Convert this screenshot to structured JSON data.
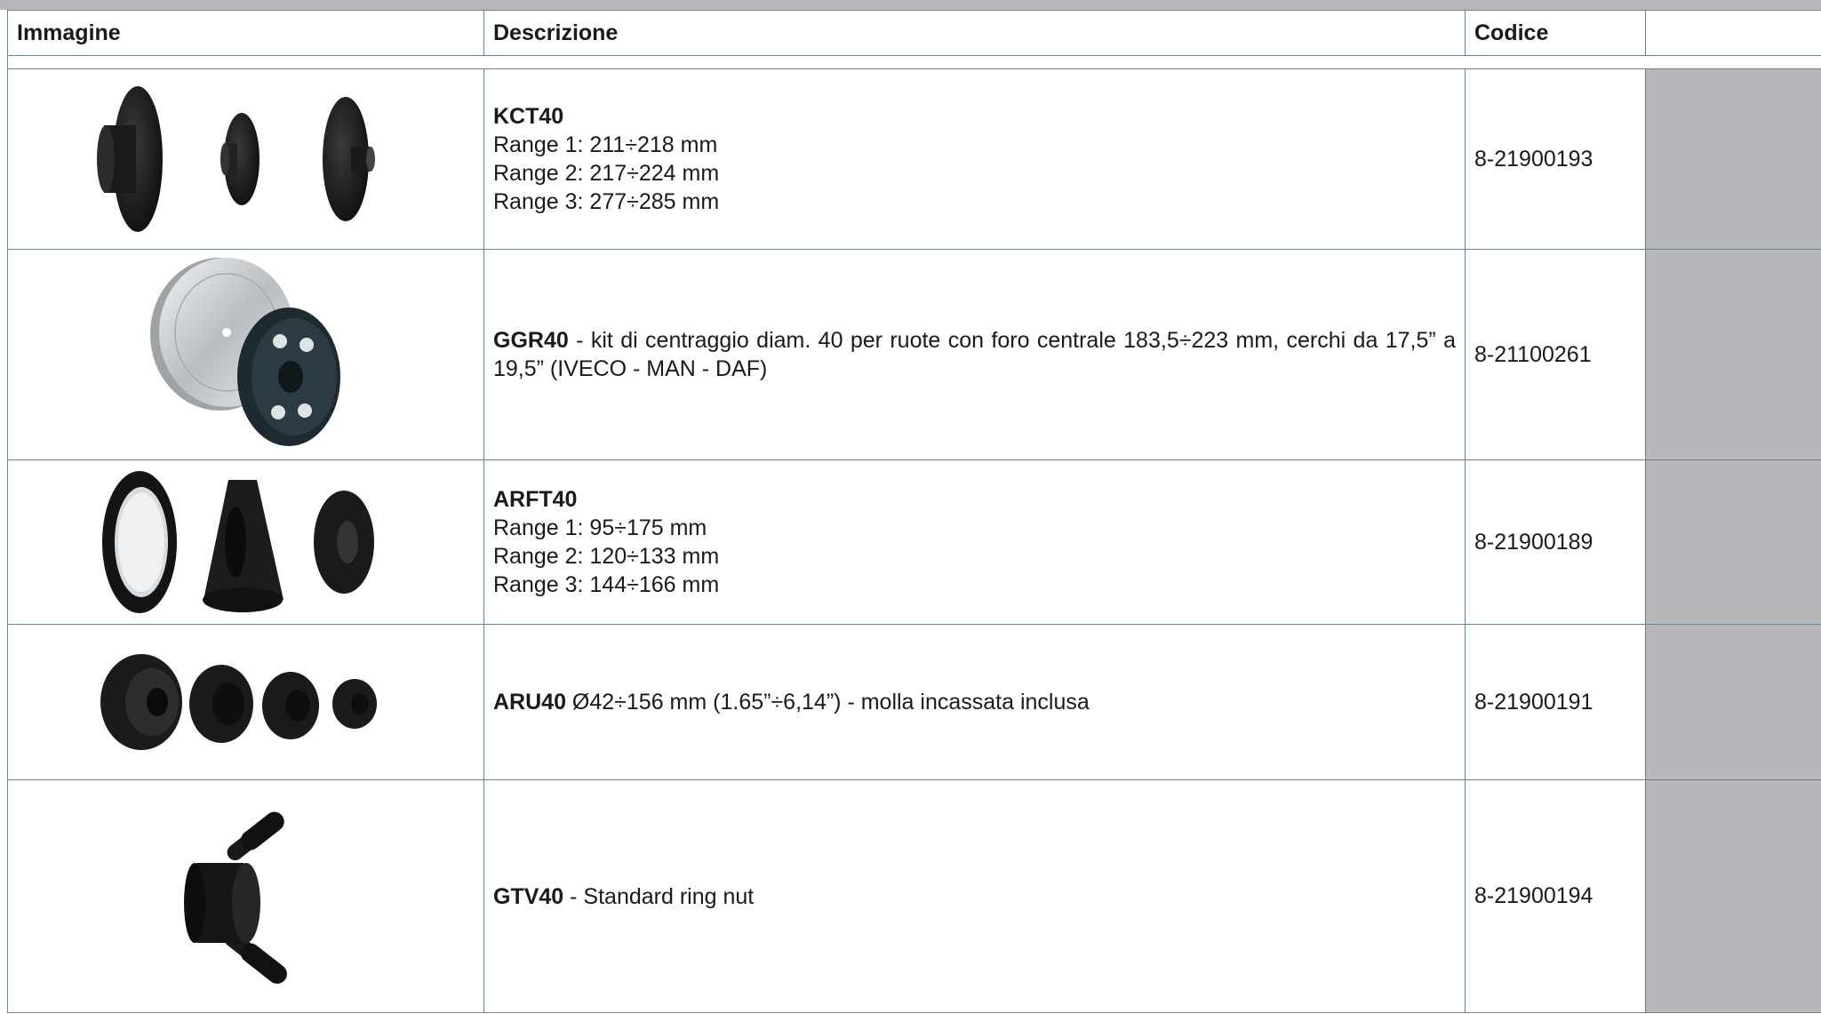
{
  "table": {
    "headers": {
      "image": "Immagine",
      "description": "Descrizione",
      "code": "Codice",
      "extra": ""
    },
    "rows": [
      {
        "name": "KCT40",
        "lines": [
          "Range 1: 211÷218 mm",
          "Range 2: 217÷224 mm",
          "Range 3: 277÷285 mm"
        ],
        "code": "8-21900193",
        "image": "three-flanged-cones"
      },
      {
        "name": "GGR40",
        "text": " - kit di centraggio diam. 40 per ruote con foro centrale 183,5÷223 mm, cerchi da 17,5” a 19,5” (IVECO - MAN - DAF)",
        "code": "8-21100261",
        "image": "centering-plate-kit"
      },
      {
        "name": "ARFT40",
        "lines": [
          "Range 1: 95÷175 mm",
          "Range 2: 120÷133 mm",
          "Range 3: 144÷166 mm"
        ],
        "code": "8-21900189",
        "image": "ring-and-two-cones"
      },
      {
        "name": "ARU40",
        "text": " Ø42÷156 mm (1.65”÷6,14”) - molla incassata inclusa",
        "code": "8-21900191",
        "image": "four-cones"
      },
      {
        "name": "GTV40",
        "text": " - Standard ring nut",
        "code": "8-21900194",
        "image": "ring-nut-with-handles"
      }
    ]
  },
  "colors": {
    "header_strip": "#b7b8bc",
    "border": "#6f7f8c",
    "side_column": "#b7b8bc"
  }
}
